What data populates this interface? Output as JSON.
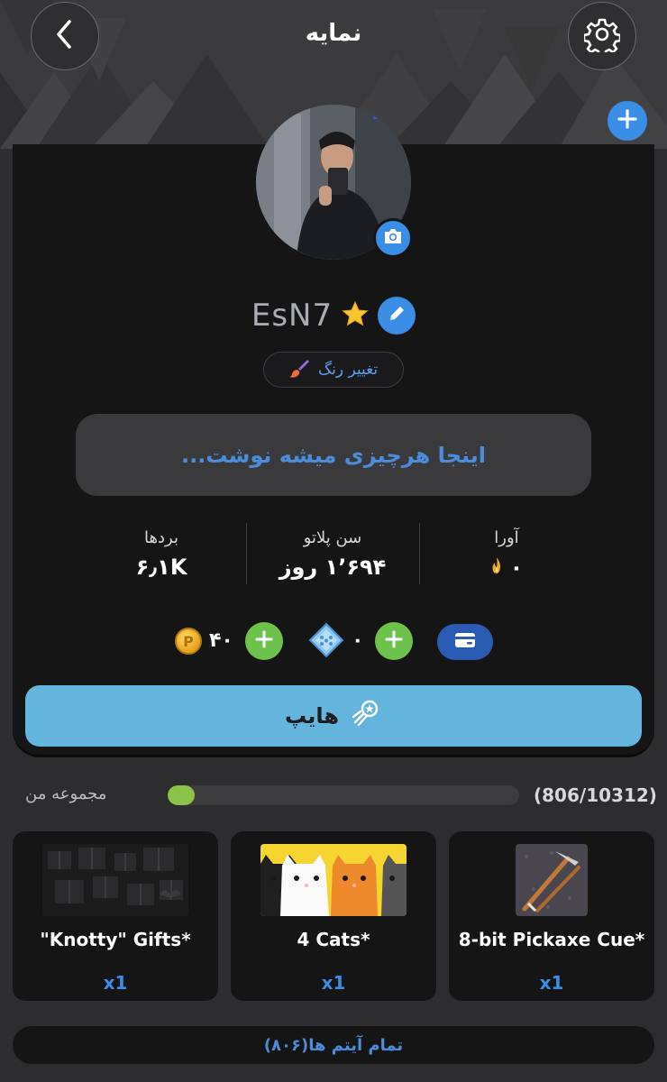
{
  "header": {
    "title": "نمایه",
    "back_icon": "chevron-left-icon",
    "settings_icon": "gear-icon",
    "add_cover_icon": "plus-icon"
  },
  "profile": {
    "username": "EsN7",
    "badge_icon": "star-icon",
    "change_color_label": "تغییر رنگ",
    "bio_placeholder": "اینجا هرچیزی میشه نوشت..."
  },
  "stats": [
    {
      "label": "بردها",
      "value": "۶٫۱K"
    },
    {
      "label": "سن پلاتو",
      "value": "۱٬۶۹۴ روز"
    },
    {
      "label": "آورا",
      "value": "۰"
    }
  ],
  "wallet": {
    "coins": "۴۰",
    "coin_letter": "P",
    "gems": "۰"
  },
  "hype_label": "هایپ",
  "collection": {
    "label": "مجموعه من",
    "count": "(806/10312)",
    "progress": 0.078
  },
  "items": [
    {
      "title": "8-bit Pickaxe Cue*",
      "qty": "x1"
    },
    {
      "title": "4 Cats*",
      "qty": "x1"
    },
    {
      "title": "\"Knotty\" Gifts*",
      "qty": "x1"
    }
  ],
  "all_items_label": "تمام آیتم ها(۸۰۶)",
  "colors": {
    "accent": "#3a8ee6",
    "green": "#6cc24a",
    "hype": "#63b5dd"
  }
}
